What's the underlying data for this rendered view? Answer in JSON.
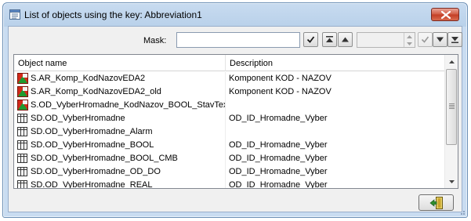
{
  "window": {
    "title": "List of objects using the key: Abbreviation1"
  },
  "toolbar": {
    "mask_label": "Mask:",
    "mask_value": "",
    "spin_value": ""
  },
  "list": {
    "columns": {
      "name": "Object name",
      "description": "Description"
    },
    "rows": [
      {
        "icon": "alarm-object-icon",
        "name": "S.AR_Komp_KodNazovEDA2",
        "description": "Komponent KOD - NAZOV"
      },
      {
        "icon": "alarm-object-icon",
        "name": "S.AR_Komp_KodNazovEDA2_old",
        "description": "Komponent KOD - NAZOV"
      },
      {
        "icon": "alarm-object-icon",
        "name": "S.OD_VyberHromadne_KodNazov_BOOL_StavText",
        "description": ""
      },
      {
        "icon": "structure-definition-icon",
        "name": "SD.OD_VyberHromadne",
        "description": "OD_ID_Hromadne_Vyber"
      },
      {
        "icon": "structure-definition-icon",
        "name": "SD.OD_VyberHromadne_Alarm",
        "description": ""
      },
      {
        "icon": "structure-definition-icon",
        "name": "SD.OD_VyberHromadne_BOOL",
        "description": "OD_ID_Hromadne_Vyber"
      },
      {
        "icon": "structure-definition-icon",
        "name": "SD.OD_VyberHromadne_BOOL_CMB",
        "description": "OD_ID_Hromadne_Vyber"
      },
      {
        "icon": "structure-definition-icon",
        "name": "SD.OD_VyberHromadne_OD_DO",
        "description": "OD_ID_Hromadne_Vyber"
      },
      {
        "icon": "structure-definition-icon",
        "name": "SD.OD_VyberHromadne_REAL",
        "description": "OD_ID_Hromadne_Vyber"
      }
    ]
  },
  "colors": {
    "titlebar": "#b9d1ea",
    "close_button": "#c9462c",
    "alarm_icon_red": "#d42a1a",
    "alarm_icon_green": "#1f9a2f"
  }
}
